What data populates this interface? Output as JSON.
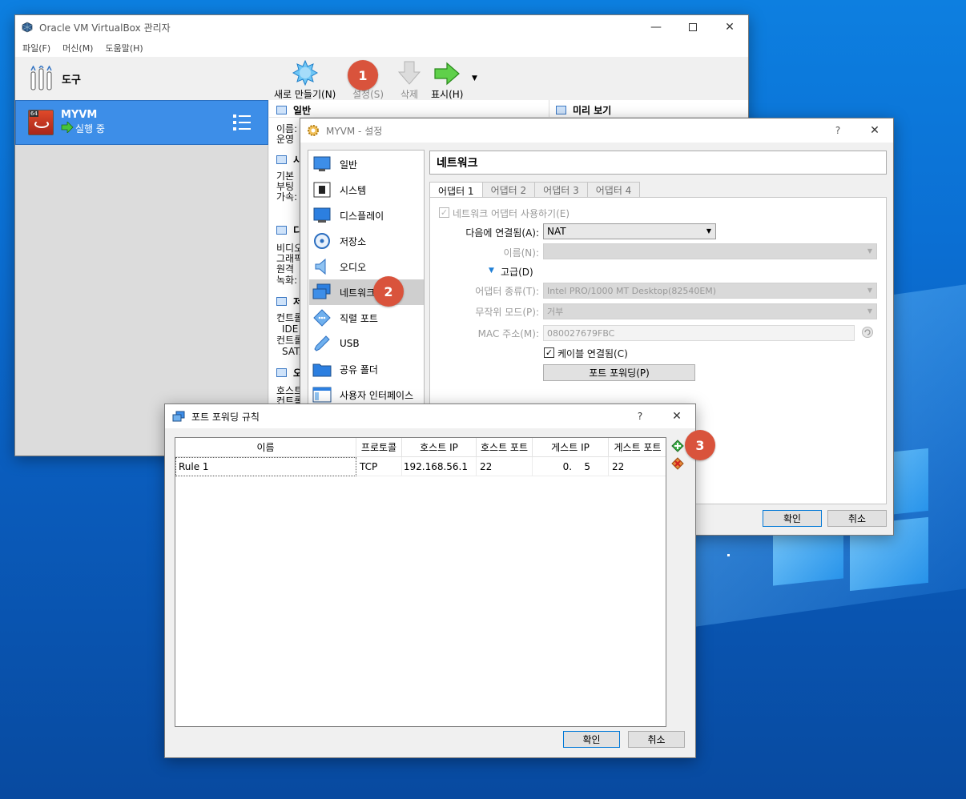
{
  "manager": {
    "title": "Oracle VM VirtualBox 관리자",
    "menu": [
      "파일(F)",
      "머신(M)",
      "도움말(H)"
    ],
    "tools_label": "도구",
    "vm": {
      "name": "MYVM",
      "state": "실행 중",
      "badge": "64"
    },
    "toolbar": {
      "new_label": "새로 만들기(N)",
      "settings_label": "설정(S)",
      "delete_label": "삭제",
      "show_label": "표시(H)"
    },
    "sections": {
      "general": "일반",
      "preview": "미리 보기",
      "general_lines": [
        "이름:",
        "운영"
      ],
      "system_head": "시",
      "system_lines": [
        "기본",
        "부팅",
        "가속:"
      ],
      "display_head": "디",
      "display_lines": [
        "비디오",
        "그래픽",
        "원격",
        "녹화:"
      ],
      "storage_head": "저",
      "storage_lines": [
        "컨트롤",
        "IDE",
        "컨트롤",
        "SATA"
      ],
      "audio_head": "오",
      "audio_lines": [
        "호스트",
        "컨트롤"
      ]
    }
  },
  "settings": {
    "title": "MYVM - 설정",
    "help": "?",
    "categories": [
      "일반",
      "시스템",
      "디스플레이",
      "저장소",
      "오디오",
      "네트워크",
      "직렬 포트",
      "USB",
      "공유 폴더",
      "사용자 인터페이스"
    ],
    "page_title": "네트워크",
    "tabs": [
      "어댑터 1",
      "어댑터 2",
      "어댑터 3",
      "어댑터 4"
    ],
    "enable_label": "네트워크 어댑터 사용하기(E)",
    "attached_label": "다음에 연결됨(A):",
    "attached_value": "NAT",
    "name_label": "이름(N):",
    "advanced_label": "고급(D)",
    "adapter_type_label": "어댑터 종류(T):",
    "adapter_type_value": "Intel PRO/1000 MT Desktop(82540EM)",
    "promisc_label": "무작위 모드(P):",
    "promisc_value": "거부",
    "mac_label": "MAC 주소(M):",
    "mac_value": "080027679FBC",
    "cable_label": "케이블 연결됨(C)",
    "port_forward_button": "포트 포워딩(P)",
    "ok": "확인",
    "cancel": "취소"
  },
  "port_forwarding": {
    "title": "포트 포워딩 규칙",
    "help": "?",
    "columns": [
      "이름",
      "프로토콜",
      "호스트 IP",
      "호스트 포트",
      "게스트 IP",
      "게스트 포트"
    ],
    "rows": [
      {
        "name": "Rule 1",
        "protocol": "TCP",
        "host_ip": "192.168.56.1",
        "host_port": "22",
        "guest_ip": "0.    5",
        "guest_port": "22"
      }
    ],
    "ok": "확인",
    "cancel": "취소"
  },
  "callouts": [
    "1",
    "2",
    "3"
  ],
  "colors": {
    "selection": "#3d8ee8",
    "callout": "#d9533c",
    "default_button_border": "#0078d7"
  }
}
